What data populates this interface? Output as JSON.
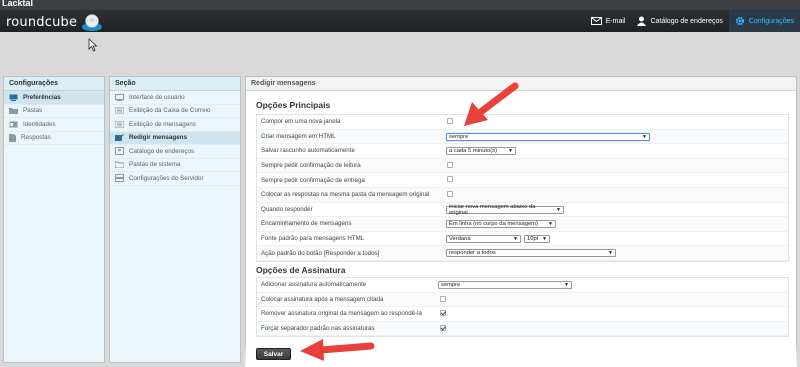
{
  "topband": {
    "text": "Lacktal"
  },
  "header": {
    "logo_text": "roundcube",
    "nav": [
      {
        "label": "E-mail",
        "icon": "envelope-icon"
      },
      {
        "label": "Catálogo de endereços",
        "icon": "person-icon"
      },
      {
        "label": "Configurações",
        "icon": "gear-icon"
      }
    ]
  },
  "left": {
    "title": "Configurações",
    "items": [
      {
        "label": "Preferências",
        "icon": "monitor-icon"
      },
      {
        "label": "Pastas",
        "icon": "folder-icon"
      },
      {
        "label": "Identidades",
        "icon": "id-card-icon"
      },
      {
        "label": "Respostas",
        "icon": "document-icon"
      }
    ]
  },
  "section": {
    "title": "Seção",
    "items": [
      {
        "label": "Interface de usuário",
        "icon": "monitor-icon"
      },
      {
        "label": "Exibição da Caixa de Correio",
        "icon": "list-icon"
      },
      {
        "label": "Exibição de mensagens",
        "icon": "list-icon"
      },
      {
        "label": "Redigir mensagens",
        "icon": "compose-icon"
      },
      {
        "label": "Catálogo de endereços",
        "icon": "contacts-icon"
      },
      {
        "label": "Pastas de sistema",
        "icon": "folders-icon"
      },
      {
        "label": "Configurações do Servidor",
        "icon": "server-icon"
      }
    ]
  },
  "main": {
    "title": "Redigir mensagens",
    "main_options_title": "Opções Principais",
    "main_options": [
      {
        "label": "Compor em uma nova janela",
        "type": "checkbox",
        "checked": false
      },
      {
        "label": "Criar mensagem em HTML",
        "type": "select",
        "value": "sempre"
      },
      {
        "label": "Salvar rascunho automaticamente",
        "type": "select",
        "value": "a cada 5 minuto(s)"
      },
      {
        "label": "Sempre pedir confirmação de leitura",
        "type": "checkbox",
        "checked": false
      },
      {
        "label": "Sempre pedir confirmação de entrega",
        "type": "checkbox",
        "checked": false
      },
      {
        "label": "Colocar as respostas na mesma pasta da mensagem original",
        "type": "checkbox",
        "checked": false
      },
      {
        "label": "Quando responder",
        "type": "select",
        "value": "iniciar nova mensagem abaixo da original"
      },
      {
        "label": "Encaminhamento de mensagens",
        "type": "select",
        "value": "Em linha (no corpo da mensagem)"
      },
      {
        "label": "Fonte padrão para mensagens HTML",
        "type": "select2",
        "value": "Verdana",
        "value2": "10pt"
      },
      {
        "label": "Ação padrão do botão [Responder a todos]",
        "type": "select",
        "value": "responder a todos"
      }
    ],
    "signature_title": "Opções de Assinatura",
    "signature_options": [
      {
        "label": "Adicionar assinatura automaticamente",
        "type": "select",
        "value": "sempre"
      },
      {
        "label": "Colocar assinatura após a mensagem citada",
        "type": "checkbox",
        "checked": false
      },
      {
        "label": "Remover assinatura original da mensagem ao respondê-la",
        "type": "checkbox",
        "checked": true
      },
      {
        "label": "Forçar separador padrão nas assinaturas",
        "type": "checkbox",
        "checked": true
      }
    ],
    "save_label": "Salvar"
  },
  "colors": {
    "accent": "#37beff",
    "annotation_arrow": "#e8403a"
  }
}
